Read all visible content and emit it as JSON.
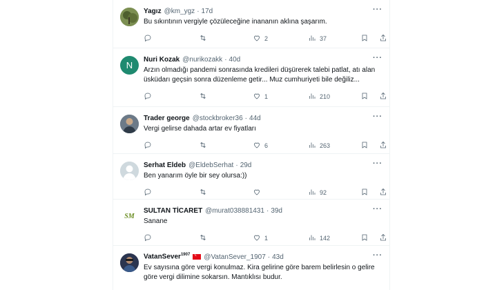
{
  "replies": [
    {
      "name": "Yagız",
      "handle": "@km_ygz",
      "dot": "·",
      "time": "17d",
      "text": "Bu sıkıntının vergiyle çözüleceğine inananın aklına şaşarım.",
      "replies": "",
      "retweets": "",
      "likes": "2",
      "views": "37",
      "avatar": {
        "kind": "photo",
        "color": "#6f7f4a"
      }
    },
    {
      "name": "Nuri Kozak",
      "handle": "@nurikozakk",
      "dot": "·",
      "time": "40d",
      "text": "Arzın olmadığı pandemi sonrasında kredileri düşürerek talebi patlat, atı alan üsküdarı geçsin sonra düzenleme getir... Muz cumhuriyeti bile değiliz...",
      "replies": "",
      "retweets": "",
      "likes": "1",
      "views": "210",
      "avatar": {
        "kind": "letter",
        "letter": "N",
        "color": "#1f8a70"
      }
    },
    {
      "name": "Trader george",
      "handle": "@stockbroker36",
      "dot": "·",
      "time": "44d",
      "text": "Vergi gelirse dahada artar ev fiyatları",
      "replies": "",
      "retweets": "",
      "likes": "6",
      "views": "263",
      "avatar": {
        "kind": "photo",
        "color": "#5a6a7a"
      }
    },
    {
      "name": "Serhat Eldeb",
      "handle": "@EldebSerhat",
      "dot": "·",
      "time": "29d",
      "text": "Ben yanarım öyle bir sey olursa:))",
      "replies": "",
      "retweets": "",
      "likes": "",
      "views": "92",
      "avatar": {
        "kind": "default",
        "color": "#cfd9de"
      }
    },
    {
      "name": "SULTAN TİCARET",
      "handle": "@murat038881431",
      "dot": "·",
      "time": "39d",
      "text": "Sanane",
      "replies": "",
      "retweets": "",
      "likes": "1",
      "views": "142",
      "avatar": {
        "kind": "logo",
        "letter": "SM",
        "color": "#ffffff"
      }
    },
    {
      "name": "VatanSever",
      "name_sup": "1907",
      "handle": "@VatanSever_1907",
      "dot": "·",
      "time": "43d",
      "text": "Ev sayısına göre vergi konulmaz. Kira gelirine göre barem belirlesin o gelire göre vergi dilimine sokarsın. Mantıklısı budur.",
      "replies": "",
      "retweets": "",
      "likes": "",
      "views": "",
      "avatar": {
        "kind": "photo",
        "color": "#2b3550"
      }
    }
  ],
  "more_label": "···",
  "icons": [
    "reply-icon",
    "retweet-icon",
    "like-icon",
    "views-icon",
    "bookmark-icon",
    "share-icon",
    "more-icon",
    "turkish-flag-icon"
  ]
}
